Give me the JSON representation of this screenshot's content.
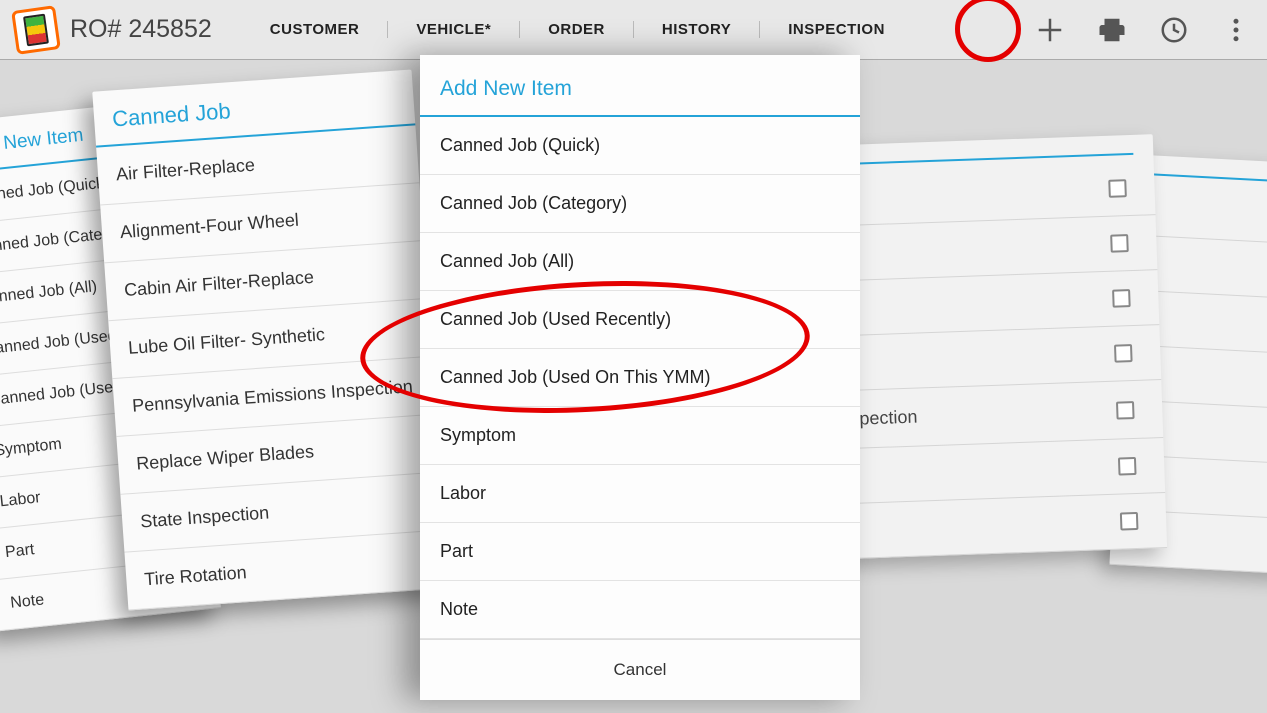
{
  "topbar": {
    "ro_number": "RO# 245852",
    "tabs": [
      "CUSTOMER",
      "VEHICLE*",
      "ORDER",
      "HISTORY",
      "INSPECTION"
    ]
  },
  "back_card_a": {
    "title": "Add New Item",
    "items": [
      "Canned Job (Quick)",
      "Canned Job (Category)",
      "Canned Job (All)",
      "Canned Job (Used Recently)",
      "Canned Job (Used On This YMM)",
      "Symptom",
      "Labor",
      "Part",
      "Note"
    ]
  },
  "back_card_b": {
    "title": "Canned Job",
    "items": [
      "Air Filter-Replace",
      "Alignment-Four Wheel",
      "Cabin Air Filter-Replace",
      "Lube Oil Filter- Synthetic",
      "Pennsylvania Emissions Inspection",
      "Replace Wiper Blades",
      "State Inspection",
      "Tire Rotation"
    ]
  },
  "checklist_c": {
    "rows": [
      {
        "label": "",
        "checked": false
      },
      {
        "label": "",
        "checked": false
      },
      {
        "label": "",
        "checked": false
      },
      {
        "label": "",
        "checked": false
      },
      {
        "label": "nspection",
        "checked": false
      },
      {
        "label": "",
        "checked": false
      },
      {
        "label": "",
        "checked": false
      }
    ]
  },
  "checklist_d": {
    "rows": [
      {
        "checked": false
      },
      {
        "checked": false
      },
      {
        "checked": false
      },
      {
        "checked": true
      },
      {
        "checked": true
      },
      {
        "checked": false
      },
      {
        "checked": true
      }
    ]
  },
  "dialog": {
    "title": "Add New Item",
    "items": [
      "Canned Job (Quick)",
      "Canned Job (Category)",
      "Canned Job (All)",
      "Canned Job (Used Recently)",
      "Canned Job (Used On This YMM)",
      "Symptom",
      "Labor",
      "Part",
      "Note"
    ],
    "cancel": "Cancel"
  }
}
